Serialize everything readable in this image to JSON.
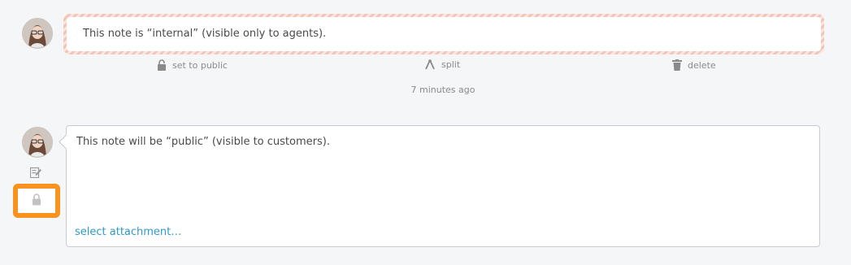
{
  "internal_note": {
    "text": "This note is “internal” (visible only to agents).",
    "actions": {
      "set_public_label": "set to public",
      "split_label": "split",
      "delete_label": "delete"
    },
    "timestamp": "7 minutes ago",
    "icons": [
      "avatar",
      "lock-icon",
      "split-icon",
      "trash-icon"
    ]
  },
  "composer": {
    "text": "This note will be “public” (visible to customers).",
    "attachment_link": "select attachment…",
    "icons": [
      "avatar",
      "edit-icon",
      "lock-icon"
    ]
  },
  "colors": {
    "internal_border": "#f5c4b8",
    "highlight": "#f7931e",
    "link": "#2f9ac8",
    "background": "#f5f6f8"
  }
}
